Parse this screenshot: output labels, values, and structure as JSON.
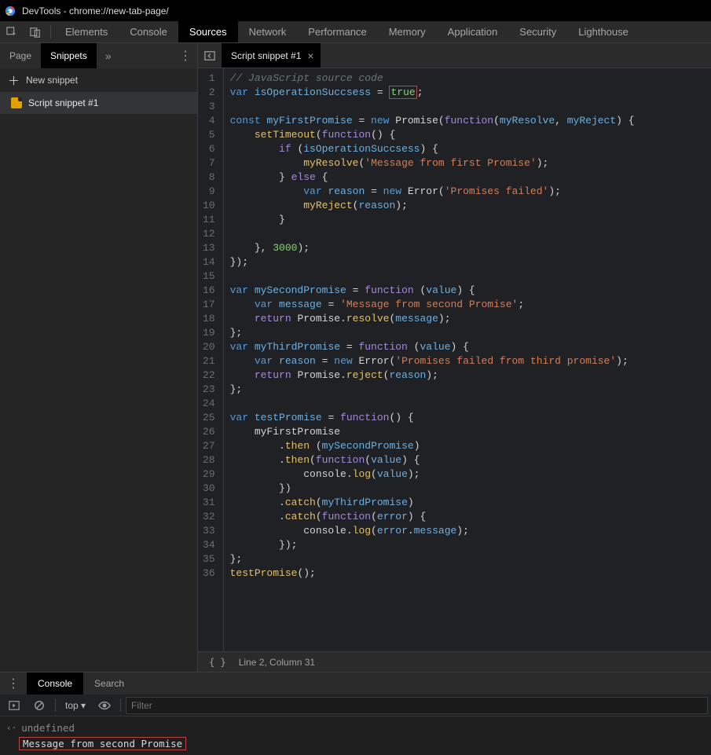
{
  "window": {
    "title": "DevTools - chrome://new-tab-page/"
  },
  "top_tabs": [
    "Elements",
    "Console",
    "Sources",
    "Network",
    "Performance",
    "Memory",
    "Application",
    "Security",
    "Lighthouse"
  ],
  "top_active": "Sources",
  "side": {
    "tabs": [
      "Page",
      "Snippets"
    ],
    "active": "Snippets",
    "new_label": "New snippet",
    "files": [
      "Script snippet #1"
    ]
  },
  "editor": {
    "tab_label": "Script snippet #1",
    "status": "Line 2, Column 31",
    "code": [
      {
        "n": 1,
        "seg": [
          {
            "t": "// JavaScript source code",
            "c": "c-comment"
          }
        ]
      },
      {
        "n": 2,
        "seg": [
          {
            "t": "var ",
            "c": "c-kw2"
          },
          {
            "t": "isOperationSuccsess",
            "c": "c-ident"
          },
          {
            "t": " = ",
            "c": "c-plain"
          },
          {
            "t": "true",
            "c": "c-bool hl-true"
          },
          {
            "t": ";",
            "c": "c-plain"
          }
        ]
      },
      {
        "n": 3,
        "seg": []
      },
      {
        "n": 4,
        "seg": [
          {
            "t": "const ",
            "c": "c-kw2"
          },
          {
            "t": "myFirstPromise",
            "c": "c-ident"
          },
          {
            "t": " = ",
            "c": "c-plain"
          },
          {
            "t": "new ",
            "c": "c-kw2"
          },
          {
            "t": "Promise",
            "c": "c-plain"
          },
          {
            "t": "(",
            "c": "c-plain"
          },
          {
            "t": "function",
            "c": "c-kw"
          },
          {
            "t": "(",
            "c": "c-plain"
          },
          {
            "t": "myResolve",
            "c": "c-ident"
          },
          {
            "t": ", ",
            "c": "c-plain"
          },
          {
            "t": "myReject",
            "c": "c-ident"
          },
          {
            "t": ") {",
            "c": "c-plain"
          }
        ]
      },
      {
        "n": 5,
        "seg": [
          {
            "t": "    ",
            "c": "c-plain"
          },
          {
            "t": "setTimeout",
            "c": "c-func"
          },
          {
            "t": "(",
            "c": "c-plain"
          },
          {
            "t": "function",
            "c": "c-kw"
          },
          {
            "t": "() {",
            "c": "c-plain"
          }
        ]
      },
      {
        "n": 6,
        "seg": [
          {
            "t": "        ",
            "c": "c-plain"
          },
          {
            "t": "if ",
            "c": "c-kw"
          },
          {
            "t": "(",
            "c": "c-plain"
          },
          {
            "t": "isOperationSuccsess",
            "c": "c-ident"
          },
          {
            "t": ") {",
            "c": "c-plain"
          }
        ]
      },
      {
        "n": 7,
        "seg": [
          {
            "t": "            ",
            "c": "c-plain"
          },
          {
            "t": "myResolve",
            "c": "c-func"
          },
          {
            "t": "(",
            "c": "c-plain"
          },
          {
            "t": "'Message from first Promise'",
            "c": "c-str"
          },
          {
            "t": ");",
            "c": "c-plain"
          }
        ]
      },
      {
        "n": 8,
        "seg": [
          {
            "t": "        } ",
            "c": "c-plain"
          },
          {
            "t": "else ",
            "c": "c-kw"
          },
          {
            "t": "{",
            "c": "c-plain"
          }
        ]
      },
      {
        "n": 9,
        "seg": [
          {
            "t": "            ",
            "c": "c-plain"
          },
          {
            "t": "var ",
            "c": "c-kw2"
          },
          {
            "t": "reason",
            "c": "c-ident"
          },
          {
            "t": " = ",
            "c": "c-plain"
          },
          {
            "t": "new ",
            "c": "c-kw2"
          },
          {
            "t": "Error",
            "c": "c-plain"
          },
          {
            "t": "(",
            "c": "c-plain"
          },
          {
            "t": "'Promises failed'",
            "c": "c-str"
          },
          {
            "t": ");",
            "c": "c-plain"
          }
        ]
      },
      {
        "n": 10,
        "seg": [
          {
            "t": "            ",
            "c": "c-plain"
          },
          {
            "t": "myReject",
            "c": "c-func"
          },
          {
            "t": "(",
            "c": "c-plain"
          },
          {
            "t": "reason",
            "c": "c-ident"
          },
          {
            "t": ");",
            "c": "c-plain"
          }
        ]
      },
      {
        "n": 11,
        "seg": [
          {
            "t": "        }",
            "c": "c-plain"
          }
        ]
      },
      {
        "n": 12,
        "seg": []
      },
      {
        "n": 13,
        "seg": [
          {
            "t": "    }, ",
            "c": "c-plain"
          },
          {
            "t": "3000",
            "c": "c-num"
          },
          {
            "t": ");",
            "c": "c-plain"
          }
        ]
      },
      {
        "n": 14,
        "seg": [
          {
            "t": "});",
            "c": "c-plain"
          }
        ]
      },
      {
        "n": 15,
        "seg": []
      },
      {
        "n": 16,
        "seg": [
          {
            "t": "var ",
            "c": "c-kw2"
          },
          {
            "t": "mySecondPromise",
            "c": "c-ident"
          },
          {
            "t": " = ",
            "c": "c-plain"
          },
          {
            "t": "function ",
            "c": "c-kw"
          },
          {
            "t": "(",
            "c": "c-plain"
          },
          {
            "t": "value",
            "c": "c-ident"
          },
          {
            "t": ") {",
            "c": "c-plain"
          }
        ]
      },
      {
        "n": 17,
        "seg": [
          {
            "t": "    ",
            "c": "c-plain"
          },
          {
            "t": "var ",
            "c": "c-kw2"
          },
          {
            "t": "message",
            "c": "c-ident"
          },
          {
            "t": " = ",
            "c": "c-plain"
          },
          {
            "t": "'Message from second Promise'",
            "c": "c-str"
          },
          {
            "t": ";",
            "c": "c-plain"
          }
        ]
      },
      {
        "n": 18,
        "seg": [
          {
            "t": "    ",
            "c": "c-plain"
          },
          {
            "t": "return ",
            "c": "c-kw"
          },
          {
            "t": "Promise",
            "c": "c-plain"
          },
          {
            "t": ".",
            "c": "c-plain"
          },
          {
            "t": "resolve",
            "c": "c-func"
          },
          {
            "t": "(",
            "c": "c-plain"
          },
          {
            "t": "message",
            "c": "c-ident"
          },
          {
            "t": ");",
            "c": "c-plain"
          }
        ]
      },
      {
        "n": 19,
        "seg": [
          {
            "t": "};",
            "c": "c-plain"
          }
        ]
      },
      {
        "n": 20,
        "seg": [
          {
            "t": "var ",
            "c": "c-kw2"
          },
          {
            "t": "myThirdPromise",
            "c": "c-ident"
          },
          {
            "t": " = ",
            "c": "c-plain"
          },
          {
            "t": "function ",
            "c": "c-kw"
          },
          {
            "t": "(",
            "c": "c-plain"
          },
          {
            "t": "value",
            "c": "c-ident"
          },
          {
            "t": ") {",
            "c": "c-plain"
          }
        ]
      },
      {
        "n": 21,
        "seg": [
          {
            "t": "    ",
            "c": "c-plain"
          },
          {
            "t": "var ",
            "c": "c-kw2"
          },
          {
            "t": "reason",
            "c": "c-ident"
          },
          {
            "t": " = ",
            "c": "c-plain"
          },
          {
            "t": "new ",
            "c": "c-kw2"
          },
          {
            "t": "Error",
            "c": "c-plain"
          },
          {
            "t": "(",
            "c": "c-plain"
          },
          {
            "t": "'Promises failed from third promise'",
            "c": "c-str"
          },
          {
            "t": ");",
            "c": "c-plain"
          }
        ]
      },
      {
        "n": 22,
        "seg": [
          {
            "t": "    ",
            "c": "c-plain"
          },
          {
            "t": "return ",
            "c": "c-kw"
          },
          {
            "t": "Promise",
            "c": "c-plain"
          },
          {
            "t": ".",
            "c": "c-plain"
          },
          {
            "t": "reject",
            "c": "c-func"
          },
          {
            "t": "(",
            "c": "c-plain"
          },
          {
            "t": "reason",
            "c": "c-ident"
          },
          {
            "t": ");",
            "c": "c-plain"
          }
        ]
      },
      {
        "n": 23,
        "seg": [
          {
            "t": "};",
            "c": "c-plain"
          }
        ]
      },
      {
        "n": 24,
        "seg": []
      },
      {
        "n": 25,
        "seg": [
          {
            "t": "var ",
            "c": "c-kw2"
          },
          {
            "t": "testPromise",
            "c": "c-ident"
          },
          {
            "t": " = ",
            "c": "c-plain"
          },
          {
            "t": "function",
            "c": "c-kw"
          },
          {
            "t": "() {",
            "c": "c-plain"
          }
        ]
      },
      {
        "n": 26,
        "seg": [
          {
            "t": "    myFirstPromise",
            "c": "c-plain"
          }
        ]
      },
      {
        "n": 27,
        "seg": [
          {
            "t": "        .",
            "c": "c-plain"
          },
          {
            "t": "then ",
            "c": "c-func"
          },
          {
            "t": "(",
            "c": "c-plain"
          },
          {
            "t": "mySecondPromise",
            "c": "c-ident"
          },
          {
            "t": ")",
            "c": "c-plain"
          }
        ]
      },
      {
        "n": 28,
        "seg": [
          {
            "t": "        .",
            "c": "c-plain"
          },
          {
            "t": "then",
            "c": "c-func"
          },
          {
            "t": "(",
            "c": "c-plain"
          },
          {
            "t": "function",
            "c": "c-kw"
          },
          {
            "t": "(",
            "c": "c-plain"
          },
          {
            "t": "value",
            "c": "c-ident"
          },
          {
            "t": ") {",
            "c": "c-plain"
          }
        ]
      },
      {
        "n": 29,
        "seg": [
          {
            "t": "            console.",
            "c": "c-plain"
          },
          {
            "t": "log",
            "c": "c-func"
          },
          {
            "t": "(",
            "c": "c-plain"
          },
          {
            "t": "value",
            "c": "c-ident"
          },
          {
            "t": ");",
            "c": "c-plain"
          }
        ]
      },
      {
        "n": 30,
        "seg": [
          {
            "t": "        })",
            "c": "c-plain"
          }
        ]
      },
      {
        "n": 31,
        "seg": [
          {
            "t": "        .",
            "c": "c-plain"
          },
          {
            "t": "catch",
            "c": "c-func"
          },
          {
            "t": "(",
            "c": "c-plain"
          },
          {
            "t": "myThirdPromise",
            "c": "c-ident"
          },
          {
            "t": ")",
            "c": "c-plain"
          }
        ]
      },
      {
        "n": 32,
        "seg": [
          {
            "t": "        .",
            "c": "c-plain"
          },
          {
            "t": "catch",
            "c": "c-func"
          },
          {
            "t": "(",
            "c": "c-plain"
          },
          {
            "t": "function",
            "c": "c-kw"
          },
          {
            "t": "(",
            "c": "c-plain"
          },
          {
            "t": "error",
            "c": "c-ident"
          },
          {
            "t": ") {",
            "c": "c-plain"
          }
        ]
      },
      {
        "n": 33,
        "seg": [
          {
            "t": "            console.",
            "c": "c-plain"
          },
          {
            "t": "log",
            "c": "c-func"
          },
          {
            "t": "(",
            "c": "c-plain"
          },
          {
            "t": "error",
            "c": "c-ident"
          },
          {
            "t": ".",
            "c": "c-plain"
          },
          {
            "t": "message",
            "c": "c-ident"
          },
          {
            "t": ");",
            "c": "c-plain"
          }
        ]
      },
      {
        "n": 34,
        "seg": [
          {
            "t": "        });",
            "c": "c-plain"
          }
        ]
      },
      {
        "n": 35,
        "seg": [
          {
            "t": "};",
            "c": "c-plain"
          }
        ]
      },
      {
        "n": 36,
        "seg": [
          {
            "t": "testPromise",
            "c": "c-func"
          },
          {
            "t": "();",
            "c": "c-plain"
          }
        ]
      }
    ]
  },
  "drawer": {
    "tabs": [
      "Console",
      "Search"
    ],
    "active": "Console",
    "scope": "top ▾",
    "filter_placeholder": "Filter",
    "rows": [
      {
        "icon": "‹·",
        "text": "undefined",
        "hl": false
      },
      {
        "icon": "",
        "text": "Message from second Promise",
        "hl": true
      }
    ]
  }
}
